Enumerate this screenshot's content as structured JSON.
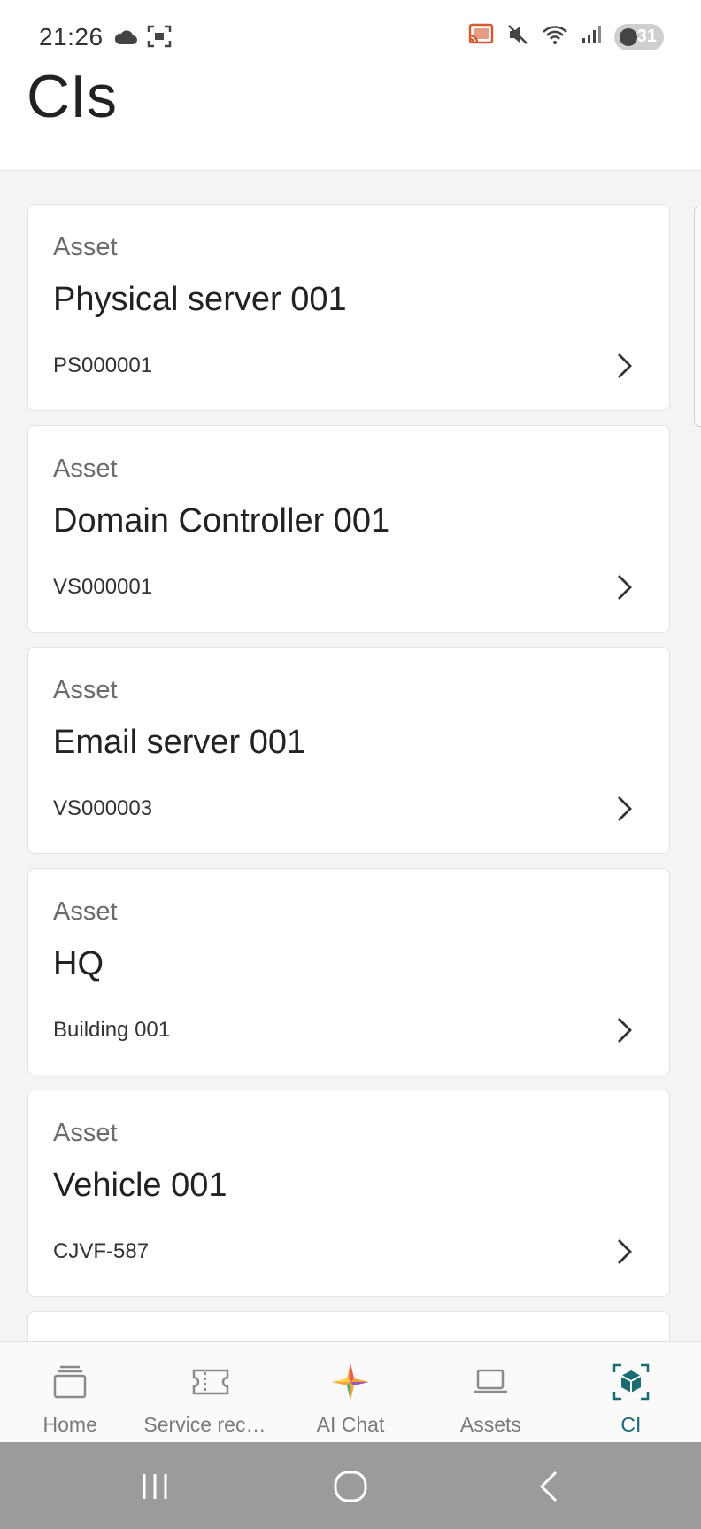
{
  "status_bar": {
    "time": "21:26",
    "battery": "31",
    "icons": [
      "cloud-icon",
      "screenshot-icon",
      "cast-icon",
      "mute-icon",
      "wifi-icon",
      "signal-icon",
      "battery-icon"
    ]
  },
  "header": {
    "title": "CIs"
  },
  "items": [
    {
      "type": "Asset",
      "name": "Physical server 001",
      "code": "PS000001"
    },
    {
      "type": "Asset",
      "name": "Domain Controller 001",
      "code": "VS000001"
    },
    {
      "type": "Asset",
      "name": "Email server 001",
      "code": "VS000003"
    },
    {
      "type": "Asset",
      "name": "HQ",
      "code": "Building 001"
    },
    {
      "type": "Asset",
      "name": "Vehicle 001",
      "code": "CJVF-587"
    }
  ],
  "bottom_nav": {
    "active": "CI",
    "accent_color": "#1b6b73",
    "items": [
      {
        "label": "Home",
        "icon": "home-stack-icon"
      },
      {
        "label": "Service recor...",
        "icon": "ticket-icon"
      },
      {
        "label": "AI Chat",
        "icon": "ai-sparkle-icon"
      },
      {
        "label": "Assets",
        "icon": "laptop-icon"
      },
      {
        "label": "CI",
        "icon": "ci-cube-icon"
      }
    ]
  },
  "system_nav": {
    "buttons": [
      "recents-button",
      "home-button",
      "back-button"
    ]
  }
}
